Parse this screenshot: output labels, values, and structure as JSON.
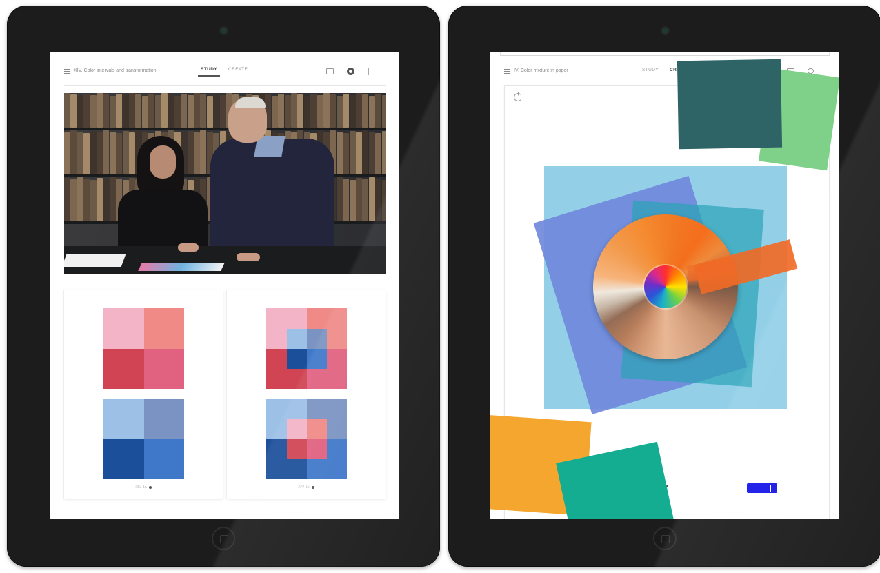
{
  "left_tablet": {
    "chapter_title": "XIV. Color intervals and transformation",
    "tabs": [
      {
        "label": "STUDY",
        "active": true
      },
      {
        "label": "CREATE",
        "active": false
      }
    ],
    "toolbar_icons": [
      "screen-icon",
      "gear-icon",
      "bookmark-icon"
    ],
    "video_description_icon": "video-frame",
    "plates": [
      {
        "pager": "XIV-1a",
        "top_grid": [
          "#f2b4c6",
          "#ef8a87",
          "#d04453",
          "#e06180"
        ],
        "bottom_grid": [
          "#9cc0e6",
          "#7b93c2",
          "#1c4f9a",
          "#3f78c9"
        ]
      },
      {
        "pager": "XIV-1b",
        "top_grid": [
          "#f2b4c6",
          "#ef8a87",
          "#d04453",
          "#e06180"
        ],
        "top_inner": [
          "#9cc0e6",
          "#7b93c2",
          "#1c4f9a",
          "#3f78c9"
        ],
        "bottom_grid": [
          "#9cc0e6",
          "#7b93c2",
          "#1c4f9a",
          "#3f78c9"
        ],
        "bottom_inner": [
          "#f2b4c6",
          "#ef8a87",
          "#d04453",
          "#e06180"
        ]
      }
    ]
  },
  "right_tablet": {
    "chapter_title": "IV. Color mixture in paper",
    "tabs": [
      {
        "label": "STUDY",
        "active": false
      },
      {
        "label": "CR",
        "active": true
      }
    ],
    "toolbar_icons": [
      "folder-icon",
      "info-icon"
    ],
    "undo_icon": "undo-icon",
    "papers": [
      {
        "name": "dark-teal-paper",
        "color": "#2f6466"
      },
      {
        "name": "light-green-paper",
        "color": "#7fd18a"
      },
      {
        "name": "light-blue-paper",
        "color": "#93d0e8"
      },
      {
        "name": "periwinkle-paper",
        "color": "#6f86db"
      },
      {
        "name": "teal-overlay-paper",
        "color": "#2da4b7"
      },
      {
        "name": "orange-strip-paper",
        "color": "#f06a26"
      },
      {
        "name": "amber-paper",
        "color": "#f5a62f"
      },
      {
        "name": "emerald-paper",
        "color": "#14ad91"
      }
    ],
    "color_wheel": "color-wheel",
    "toggle_color": "#1616e8"
  }
}
